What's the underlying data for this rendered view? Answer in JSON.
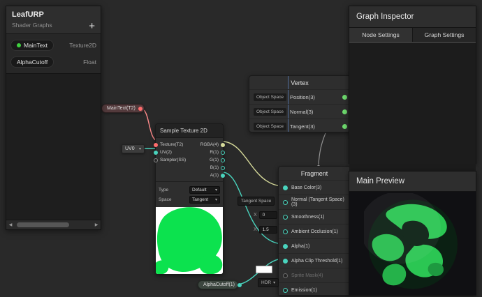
{
  "colors": {
    "canvas_bg": "#292929",
    "accent_green": "#3fd13f",
    "port_teal": "#49d3bd",
    "port_green": "#6fdc6f",
    "port_red": "#ff6d6d",
    "port_vector4_yellow": "#d6da9a",
    "texture_preview_green": "#0ce24e",
    "wire_red": "#ff8a8a",
    "wire_teal": "#49d3bd",
    "wire_yellow": "#d6da9a"
  },
  "blackboard": {
    "title": "LeafURP",
    "subtitle": "Shader Graphs",
    "add_button": "+",
    "properties": [
      {
        "name": "MainText",
        "type": "Texture2D"
      },
      {
        "name": "AlphaCutoff",
        "type": "Float"
      }
    ]
  },
  "graph_inspector": {
    "title": "Graph Inspector",
    "tabs": [
      "Node Settings",
      "Graph Settings"
    ]
  },
  "main_preview": {
    "title": "Main Preview"
  },
  "graph": {
    "maintext_node": {
      "label": "MainText(T2)"
    },
    "uv_node": {
      "label": "UV0"
    },
    "alphacutoff_node": {
      "label": "AlphaCutoff(1)"
    },
    "sample_texture_node": {
      "title": "Sample Texture 2D",
      "inputs": [
        {
          "label": "Texture(T2)"
        },
        {
          "label": "UV(2)"
        },
        {
          "label": "Sampler(SS)"
        }
      ],
      "outputs": [
        {
          "label": "RGBA(4)"
        },
        {
          "label": "R(1)"
        },
        {
          "label": "G(1)"
        },
        {
          "label": "B(1)"
        },
        {
          "label": "A(1)"
        }
      ],
      "type_label": "Type",
      "type_value": "Default",
      "space_label": "Space",
      "space_value": "Tangent"
    },
    "vertex_node": {
      "title": "Vertex",
      "rows": [
        {
          "space": "Object Space",
          "label": "Position(3)"
        },
        {
          "space": "Object Space",
          "label": "Normal(3)"
        },
        {
          "space": "Object Space",
          "label": "Tangent(3)"
        }
      ]
    },
    "fragment_node": {
      "title": "Fragment",
      "rows": [
        {
          "label": "Base Color(3)"
        },
        {
          "label": "Normal (Tangent Space)(3)"
        },
        {
          "label": "Smoothness(1)"
        },
        {
          "label": "Ambient Occlusion(1)"
        },
        {
          "label": "Alpha(1)"
        },
        {
          "label": "Alpha Clip Threshold(1)"
        },
        {
          "label": "Sprite Mask(4)"
        },
        {
          "label": "Emission(1)"
        }
      ],
      "normal_space_value": "Tangent Space",
      "smoothness_prefix": "X",
      "smoothness_value": "0",
      "ao_prefix": "X",
      "ao_value": "1.5",
      "emission_mode": "HDR"
    }
  }
}
